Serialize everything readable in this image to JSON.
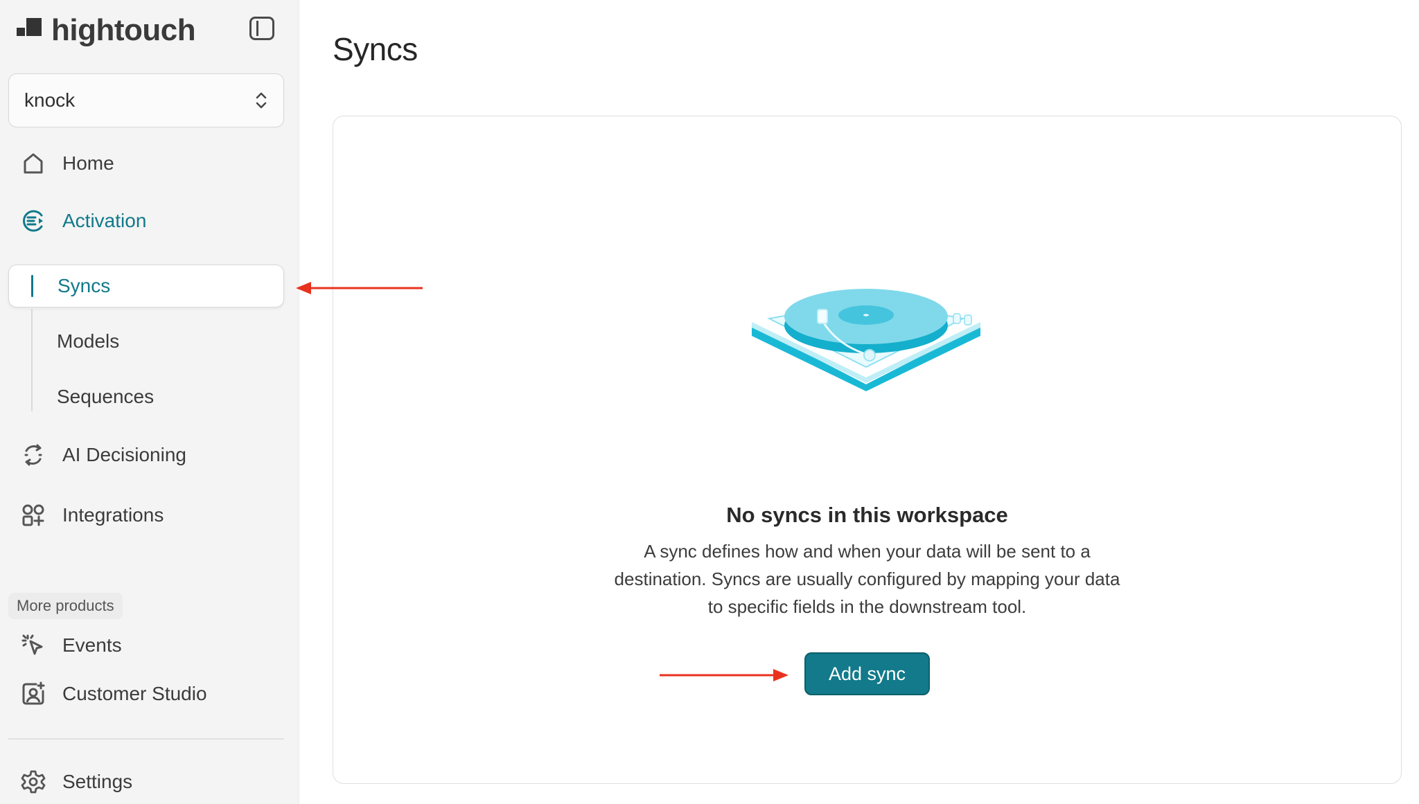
{
  "brand": {
    "name": "hightouch"
  },
  "workspace": {
    "name": "knock"
  },
  "nav": {
    "home": "Home",
    "activation": "Activation",
    "syncs": "Syncs",
    "models": "Models",
    "sequences": "Sequences",
    "ai_decisioning": "AI Decisioning",
    "integrations": "Integrations",
    "more_products": "More products",
    "events": "Events",
    "customer_studio": "Customer Studio",
    "settings": "Settings"
  },
  "main": {
    "title": "Syncs",
    "empty_state": {
      "title": "No syncs in this workspace",
      "description": "A sync defines how and when your data will be sent to a destination. Syncs are usually configured by mapping your data to specific fields in the downstream tool.",
      "button_label": "Add sync"
    }
  },
  "colors": {
    "accent": "#11798a",
    "button": "#127a8a",
    "annotation_arrow": "#e8321e",
    "sidebar_bg": "#f4f4f4"
  },
  "icons": [
    "home-icon",
    "activation-icon",
    "ai-decisioning-icon",
    "integrations-icon",
    "events-icon",
    "customer-studio-icon",
    "settings-icon",
    "sidebar-collapse-icon",
    "chevron-updown-icon"
  ]
}
